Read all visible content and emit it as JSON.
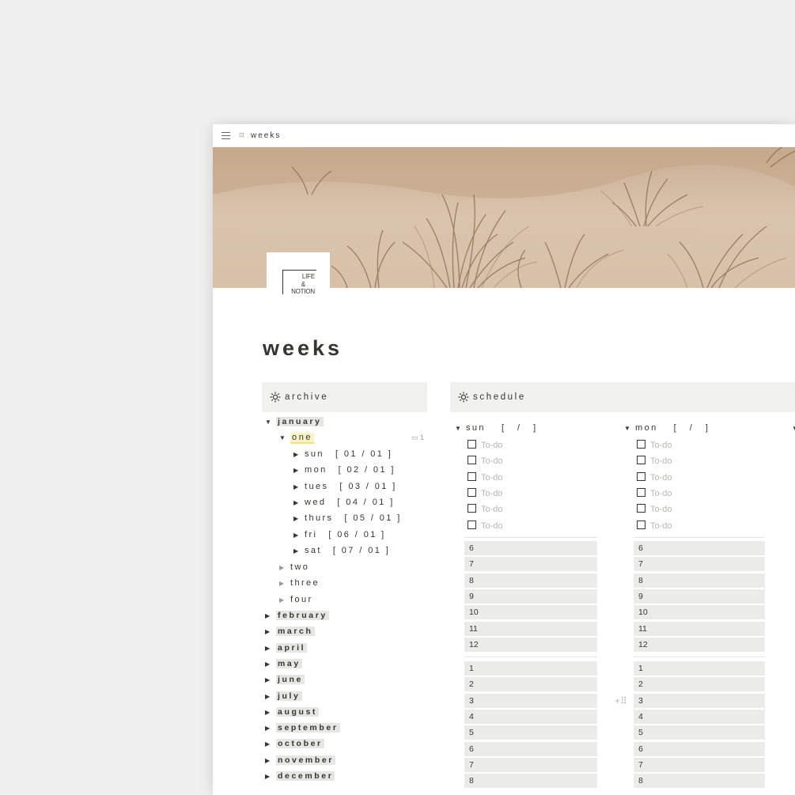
{
  "topbar": {
    "page_icon": "⊡",
    "breadcrumb": "weeks"
  },
  "logo": {
    "line1": "LIFE",
    "line2": "&",
    "line3": "NOTION"
  },
  "page_title": "weeks",
  "archive": {
    "title": "archive",
    "months_open": {
      "label": "january"
    },
    "week_open": {
      "label": "one",
      "comment_count": "1"
    },
    "days": [
      {
        "name": "sun",
        "date": "[ 01 / 01 ]"
      },
      {
        "name": "mon",
        "date": "[ 02 / 01 ]"
      },
      {
        "name": "tues",
        "date": "[ 03 / 01 ]"
      },
      {
        "name": "wed",
        "date": "[ 04 / 01 ]"
      },
      {
        "name": "thurs",
        "date": "[ 05 / 01 ]"
      },
      {
        "name": "fri",
        "date": "[ 06 / 01 ]"
      },
      {
        "name": "sat",
        "date": "[ 07 / 01 ]"
      }
    ],
    "weeks_closed": [
      "two",
      "three",
      "four"
    ],
    "months_closed": [
      "february",
      "march",
      "april",
      "may",
      "june",
      "july",
      "august",
      "september",
      "october",
      "november",
      "december"
    ]
  },
  "schedule": {
    "title": "schedule",
    "columns": [
      {
        "day": "sun",
        "date": "[ / ]"
      },
      {
        "day": "mon",
        "date": "[ / ]"
      }
    ],
    "todo_placeholder": "To-do",
    "todo_count": 6,
    "morning_hours": [
      "6",
      "7",
      "8",
      "9",
      "10",
      "11",
      "12"
    ],
    "afternoon_hours": [
      "1",
      "2",
      "3",
      "4",
      "5",
      "6",
      "7",
      "8"
    ]
  },
  "colors": {
    "background": "#f0f0f0",
    "callout": "#f1f1ef",
    "hour_block": "#ebebea",
    "highlight": "#fbf3c6"
  }
}
